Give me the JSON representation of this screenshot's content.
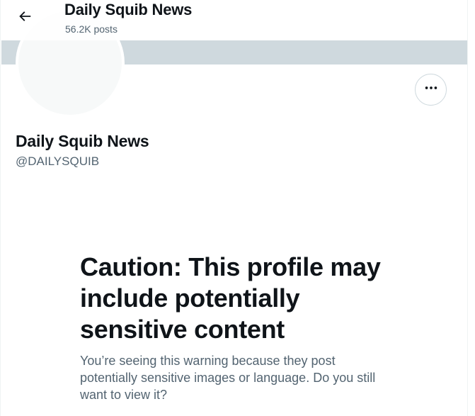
{
  "header": {
    "title": "Daily Squib News",
    "subtitle": "56.2K posts",
    "back_icon": "arrow-left-icon"
  },
  "profile": {
    "name": "Daily Squib News",
    "handle": "@DAILYSQUIB",
    "more_icon": "more-horizontal-icon"
  },
  "warning": {
    "title": "Caution: This profile may include potentially sensitive content",
    "body": "You’re seeing this warning because they post potentially sensitive images or language. Do you still want to view it?"
  },
  "colors": {
    "banner": "#cfd9de",
    "text_primary": "#0f1419",
    "text_secondary": "#536471",
    "avatar_placeholder": "#f7f9f9"
  }
}
